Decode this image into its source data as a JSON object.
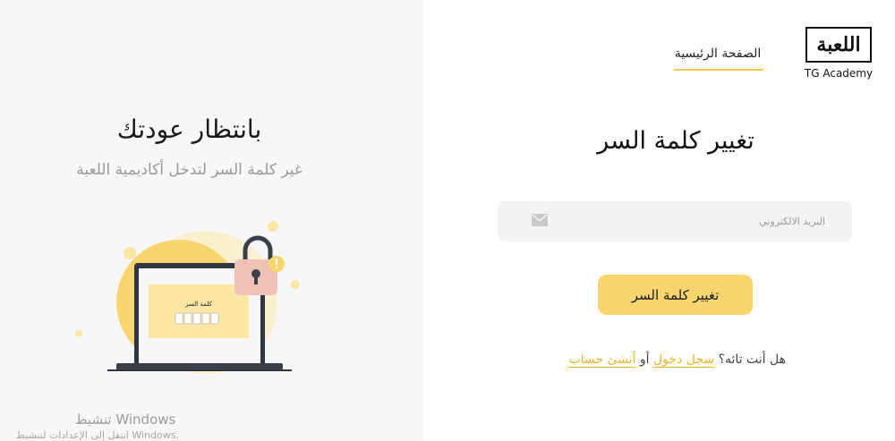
{
  "header": {
    "logo_text": "TG Academy",
    "nav_home": "الصفحة الرئيسية"
  },
  "left": {
    "title": "بانتظار عودتك",
    "subtitle": "غير كلمة السر لتدخل أكاديمية اللعبة",
    "screen_label": "كلمة السر"
  },
  "form": {
    "title": "تغيير كلمة السر",
    "email_placeholder": "البريد الالكتروني",
    "submit_label": "تغيير كلمة السر",
    "lost_text": "هل أنت تائه؟",
    "login_link": "سجل دخول",
    "or_text": "أو",
    "register_link": "أنشئ حساب"
  },
  "windows": {
    "activate_title": "تنشيط Windows",
    "activate_sub": "انتقل إلى الإعدادات لتنشيط Windows."
  },
  "colors": {
    "accent": "#fad46e",
    "link": "#e7b52c",
    "panel": "#f7f7f7"
  }
}
